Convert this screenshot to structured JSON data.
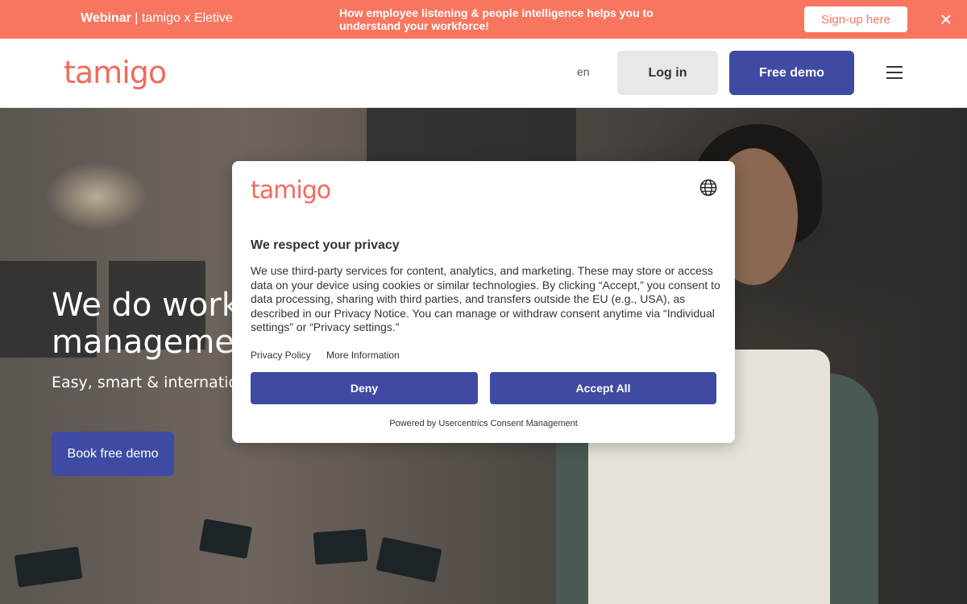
{
  "banner": {
    "tag_bold": "Webinar",
    "tag_rest": " | tamigo x Eletive",
    "message": "How employee listening & people intelligence helps you to understand your workforce!",
    "cta_label": "Sign-up here"
  },
  "header": {
    "logo_text": "tamigo",
    "language": "en",
    "login_label": "Log in",
    "demo_label": "Free demo"
  },
  "hero": {
    "title_line1": "We do workf",
    "title_line2": "managemen",
    "subtitle": "Easy, smart & internationa",
    "cta_label": "Book free demo"
  },
  "consent": {
    "logo_text": "tamigo",
    "title": "We respect your privacy",
    "body": "We use third-party services for content, analytics, and marketing. These may store or access data on your device using cookies or similar technologies. By clicking “Accept,” you consent to data processing, sharing with third parties, and transfers outside the EU (e.g., USA), as described in our Privacy Notice. You can manage or withdraw consent anytime via “Individual settings” or “Privacy settings.”",
    "link_privacy": "Privacy Policy",
    "link_more": "More Information",
    "deny_label": "Deny",
    "accept_label": "Accept All",
    "powered_by": "Powered by Usercentrics Consent Management"
  },
  "colors": {
    "banner_bg": "#f87660",
    "brand_blue": "#3f4aa3",
    "logo_coral": "#f26b5b"
  }
}
